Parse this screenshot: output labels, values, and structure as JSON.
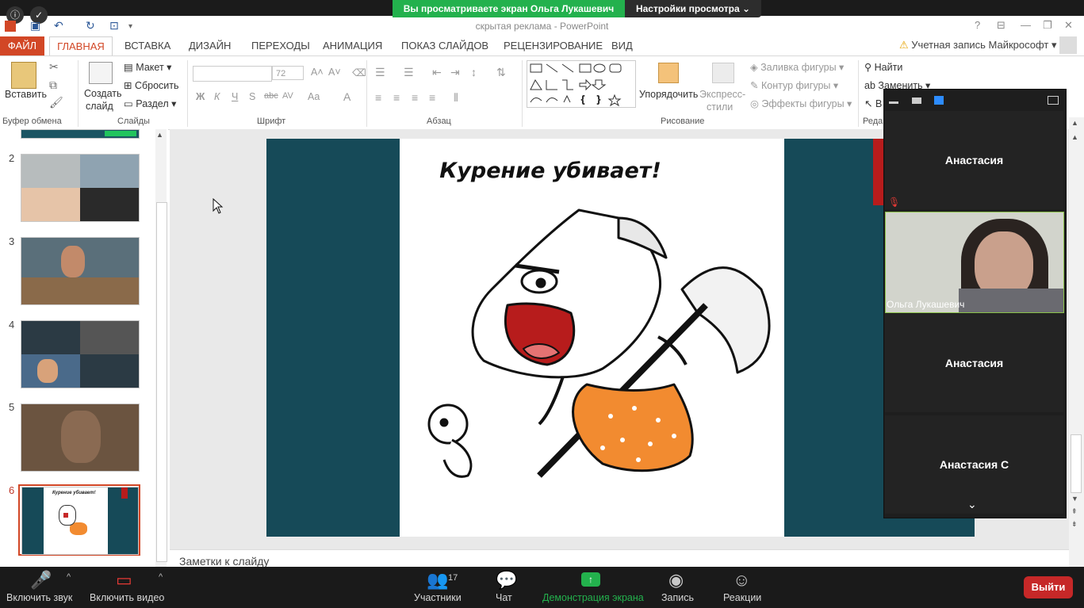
{
  "window": {
    "title": "скрытая реклама - PowerPoint",
    "share_banner": "Вы просматриваете экран Ольга Лукашевич",
    "view_settings": "Настройки просмотра",
    "help": "?"
  },
  "tabs": [
    "ФАЙЛ",
    "ГЛАВНАЯ",
    "ВСТАВКА",
    "ДИЗАЙН",
    "ПЕРЕХОДЫ",
    "АНИМАЦИЯ",
    "ПОКАЗ СЛАЙДОВ",
    "РЕЦЕНЗИРОВАНИЕ",
    "ВИД"
  ],
  "account": "Учетная запись Майкрософт",
  "ribbon": {
    "paste": "Вставить",
    "clipboard": "Буфер обмена",
    "new_slide_1": "Создать",
    "new_slide_2": "слайд",
    "layout": "Макет",
    "reset": "Сбросить",
    "section": "Раздел",
    "slides": "Слайды",
    "font_size": "72",
    "font": "Шрифт",
    "paragraph": "Абзац",
    "arrange": "Упорядочить",
    "express_1": "Экспресс-",
    "express_2": "стили",
    "shape_fill": "Заливка фигуры",
    "shape_outline": "Контур фигуры",
    "shape_effects": "Эффекты фигуры",
    "drawing": "Рисование",
    "find": "Найти",
    "replace": "Заменить",
    "select": "В",
    "editing": "Реда",
    "bold": "Ж",
    "italic": "К",
    "underline": "Ч",
    "shadow": "S",
    "strike": "abc",
    "spacing": "AV",
    "case": "Aa",
    "color": "A"
  },
  "slides": [
    {
      "num": "2"
    },
    {
      "num": "3"
    },
    {
      "num": "4"
    },
    {
      "num": "5"
    },
    {
      "num": "6",
      "selected": true
    }
  ],
  "slide": {
    "title": "Курение убивает!",
    "thumb_title": "Курение убивает!"
  },
  "notes": "Заметки к слайду",
  "participants_panel": {
    "tiles": [
      "Анастасия",
      "Анастасия",
      "Анастасия С"
    ],
    "video_name": "Ольга Лукашевич"
  },
  "zoom_bar": {
    "mute": "Включить звук",
    "video": "Включить видео",
    "participants": "Участники",
    "participants_count": "17",
    "chat": "Чат",
    "share": "Демонстрация экрана",
    "record": "Запись",
    "reactions": "Реакции",
    "exit": "Выйти"
  }
}
